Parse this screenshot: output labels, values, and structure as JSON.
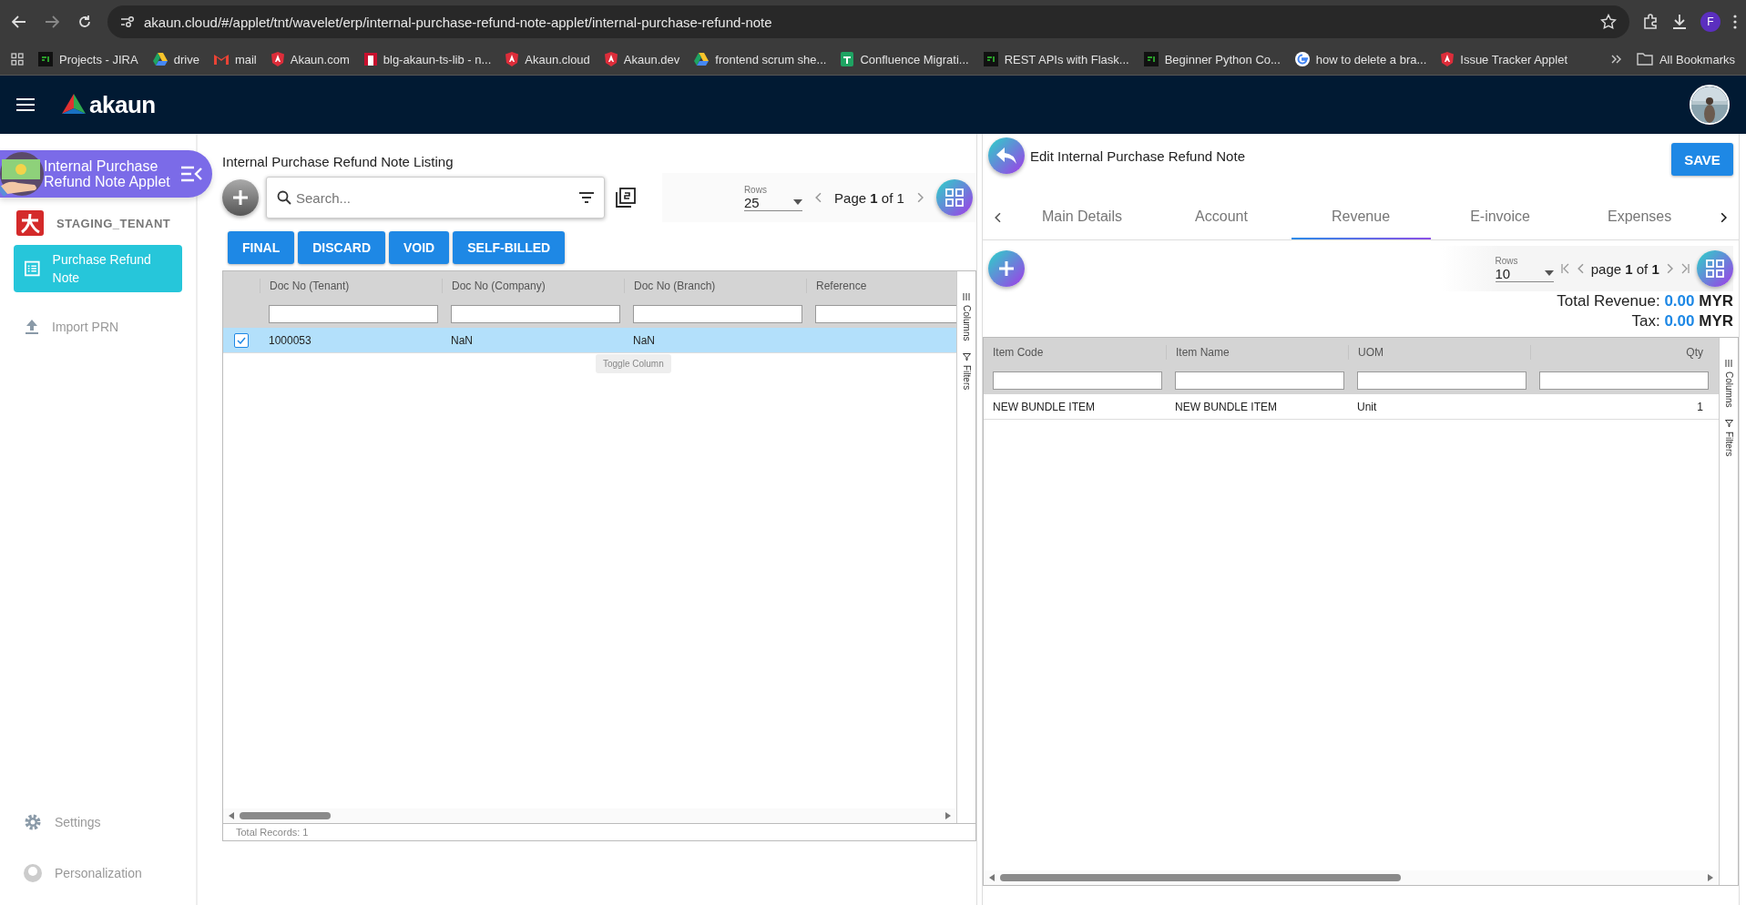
{
  "browser": {
    "url": "akaun.cloud/#/applet/tnt/wavelet/erp/internal-purchase-refund-note-applet/internal-purchase-refund-note",
    "profile_initial": "F",
    "bookmarks": [
      {
        "label": "Projects - JIRA",
        "kind": "terminal"
      },
      {
        "label": "drive",
        "kind": "drive"
      },
      {
        "label": "mail",
        "kind": "mail"
      },
      {
        "label": "Akaun.com",
        "kind": "shield"
      },
      {
        "label": "blg-akaun-ts-lib - n...",
        "kind": "square"
      },
      {
        "label": "Akaun.cloud",
        "kind": "shield"
      },
      {
        "label": "Akaun.dev",
        "kind": "shield"
      },
      {
        "label": "frontend scrum she...",
        "kind": "drive"
      },
      {
        "label": "Confluence Migrati...",
        "kind": "sheet"
      },
      {
        "label": "REST APIs with Flask...",
        "kind": "terminal"
      },
      {
        "label": "Beginner Python Co...",
        "kind": "terminal"
      },
      {
        "label": "how to delete a bra...",
        "kind": "google"
      },
      {
        "label": "Issue Tracker Applet",
        "kind": "shield"
      }
    ],
    "all_bookmarks": "All Bookmarks"
  },
  "app": {
    "brand": "akaun"
  },
  "sidebar": {
    "applet_title": "Internal Purchase Refund Note Applet",
    "tenant": "STAGING_TENANT",
    "items": [
      {
        "label": "Purchase Refund Note",
        "selected": true,
        "kind": "list"
      },
      {
        "label": "Import PRN",
        "selected": false,
        "kind": "upload"
      }
    ],
    "bottom": [
      {
        "label": "Settings",
        "kind": "gear"
      },
      {
        "label": "Personalization",
        "kind": "person"
      }
    ]
  },
  "listing": {
    "title": "Internal Purchase Refund Note Listing",
    "search": {
      "placeholder": "Search..."
    },
    "tooltip": "Toggle Column",
    "rows_label": "Rows",
    "rows_value": "25",
    "pager": "Page **1** of 1",
    "actions": [
      "FINAL",
      "DISCARD",
      "VOID",
      "SELF-BILLED"
    ],
    "columns": [
      "Doc No (Tenant)",
      "Doc No (Company)",
      "Doc No (Branch)",
      "Reference"
    ],
    "rows": [
      {
        "checked": true,
        "selected": true,
        "cells": [
          "1000053",
          "NaN",
          "NaN"
        ]
      }
    ],
    "side_tabs": [
      "Columns",
      "Filters"
    ],
    "footer": "Total Records: 1"
  },
  "editor": {
    "title": "Edit Internal Purchase Refund Note",
    "save": "SAVE",
    "tabs": [
      {
        "label": "Main Details",
        "selected": false
      },
      {
        "label": "Account",
        "selected": false
      },
      {
        "label": "Revenue",
        "selected": true
      },
      {
        "label": "E-invoice",
        "selected": false
      },
      {
        "label": "Expenses",
        "selected": false
      }
    ],
    "rows_label": "Rows",
    "rows_value": "10",
    "pager": "page **1** of **1**",
    "totals": [
      {
        "label": "Total Revenue:",
        "amount": "0.00",
        "currency": "MYR"
      },
      {
        "label": "Tax:",
        "amount": "0.00",
        "currency": "MYR"
      }
    ],
    "columns": [
      "Item Code",
      "Item Name",
      "UOM",
      "Qty"
    ],
    "rows": [
      [
        "NEW BUNDLE ITEM",
        "NEW BUNDLE ITEM",
        "Unit",
        "1"
      ]
    ],
    "side_tabs": [
      "Columns",
      "Filters"
    ]
  }
}
